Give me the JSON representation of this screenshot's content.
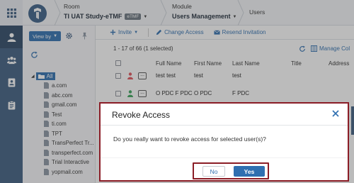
{
  "header": {
    "room_label": "Room",
    "room_value": "TI UAT Study-eTMF",
    "room_badge": "eTMF",
    "module_label": "Module",
    "module_value": "Users Management",
    "page_label": "Users"
  },
  "tree": {
    "view_by_label": "View by",
    "root_label": "All",
    "nodes": [
      "a.com",
      "abc.com",
      "gmail.com",
      "Test",
      "ti.com",
      "TPT",
      "TransPerfect Tr...",
      "transperfect.com",
      "Trial Interactive",
      "yopmail.com"
    ]
  },
  "toolbar": {
    "invite_label": "Invite",
    "change_access_label": "Change Access",
    "resend_invitation_label": "Resend Invitation"
  },
  "list": {
    "count_text": "1 - 17 of 66 (1 selected)",
    "manage_label": "Manage Col",
    "columns": [
      "Full Name",
      "First Name",
      "Last Name",
      "Title",
      "Address"
    ],
    "rows": [
      {
        "full_name": "test test",
        "first_name": "test",
        "last_name": "test",
        "dots": "..."
      },
      {
        "full_name": "O PDC F PDC",
        "first_name": "O PDC",
        "last_name": "F PDC",
        "dots": "..."
      }
    ]
  },
  "modal": {
    "title": "Revoke Access",
    "message": "Do you really want to revoke access for selected user(s)?",
    "no_label": "No",
    "yes_label": "Yes"
  },
  "colors": {
    "primary": "#2f6fb0",
    "rail": "#3d5d80",
    "highlight_border": "#8b1d26"
  }
}
